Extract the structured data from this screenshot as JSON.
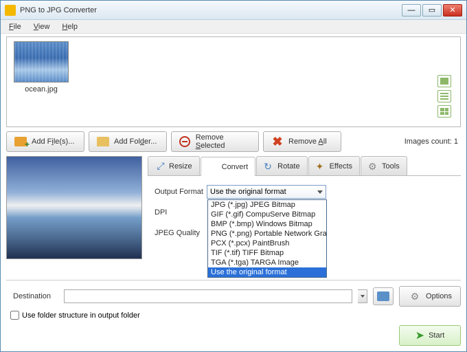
{
  "window": {
    "title": "PNG to JPG Converter"
  },
  "menu": {
    "file": "File",
    "view": "View",
    "help": "Help"
  },
  "thumbnail": {
    "label": "ocean.jpg"
  },
  "buttons": {
    "addfiles_pre": "Add F",
    "addfiles_hot": "i",
    "addfiles_post": "le(s)...",
    "addfolder_pre": "Add Fol",
    "addfolder_hot": "d",
    "addfolder_post": "er...",
    "removesel_pre": "Remove ",
    "removesel_hot": "S",
    "removesel_post": "elected",
    "removeall_pre": "Remove ",
    "removeall_hot": "A",
    "removeall_post": "ll"
  },
  "count_label": "Images count: 1",
  "tabs": {
    "resize": "Resize",
    "convert": "Convert",
    "rotate": "Rotate",
    "effects": "Effects",
    "tools": "Tools"
  },
  "form": {
    "output_format": "Output Format",
    "dpi": "DPI",
    "jpeg_quality": "JPEG Quality",
    "selected_format": "Use the original format",
    "options": [
      "JPG (*.jpg) JPEG Bitmap",
      "GIF (*.gif) CompuServe Bitmap",
      "BMP (*.bmp) Windows Bitmap",
      "PNG (*.png) Portable Network Graphics",
      "PCX (*.pcx) PaintBrush",
      "TIF (*.tif) TIFF Bitmap",
      "TGA (*.tga) TARGA Image",
      "Use the original format"
    ]
  },
  "dest": {
    "label": "Destination"
  },
  "options_btn": "Options",
  "chk_label": "Use folder structure in output folder",
  "start_btn": "Start"
}
